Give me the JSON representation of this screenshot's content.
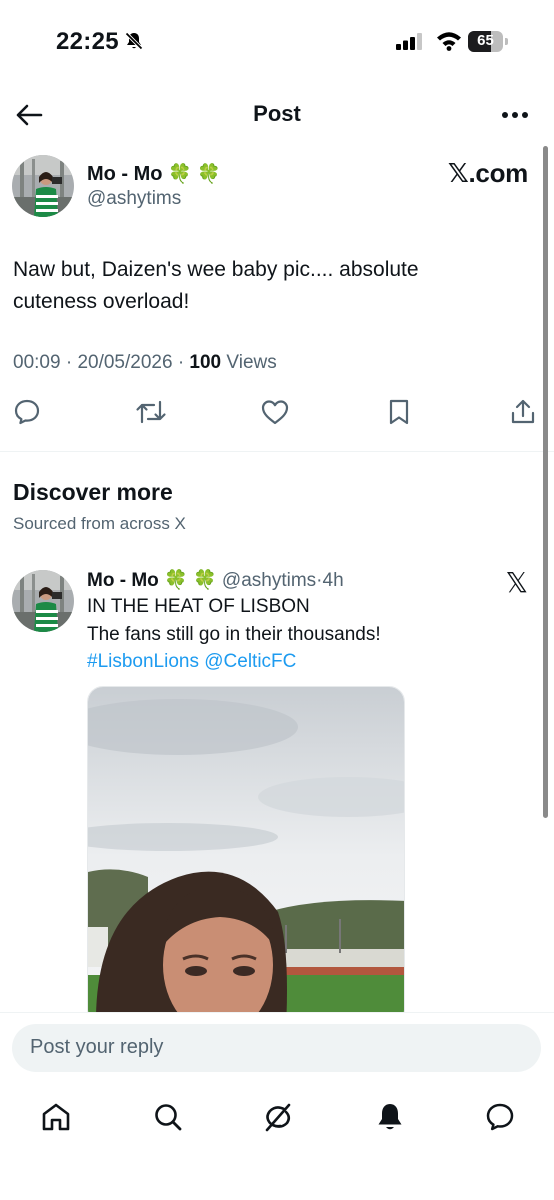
{
  "status_bar": {
    "time": "22:25",
    "battery_percent": "65",
    "battery_level": 0.65
  },
  "header": {
    "title": "Post"
  },
  "post": {
    "author_name": "Mo - Mo",
    "author_emoji": "🍀 🍀",
    "handle": "@ashytims",
    "source_label": "𝕏.com",
    "text_line1": "Naw but, Daizen's wee baby pic....  absolute",
    "text_line2": "cuteness overload!",
    "time": "00:09",
    "date": "20/05/2026",
    "separator": "·",
    "views_count": "100",
    "views_label": "Views"
  },
  "actions": [
    "reply-icon",
    "repost-icon",
    "like-icon",
    "bookmark-icon",
    "share-icon"
  ],
  "discover": {
    "title": "Discover more",
    "subtitle": "Sourced from across X"
  },
  "recommended": {
    "author_name": "Mo - Mo",
    "author_emoji": "🍀 🍀",
    "handle": "@ashytims",
    "separator": "·",
    "age": "4h",
    "x_mark": "𝕏",
    "line1": "IN THE HEAT OF LISBON",
    "line2": "The fans still go in their thousands!",
    "hashtags": "#LisbonLions @CelticFC"
  },
  "reply": {
    "placeholder": "Post your reply"
  },
  "tabs": [
    "home-icon",
    "search-icon",
    "grok-icon",
    "notifications-icon",
    "messages-icon"
  ],
  "colors": {
    "link": "#1d9bf0",
    "text": "#0f1419",
    "secondary": "#536471",
    "clover": "#2e9a3c"
  }
}
